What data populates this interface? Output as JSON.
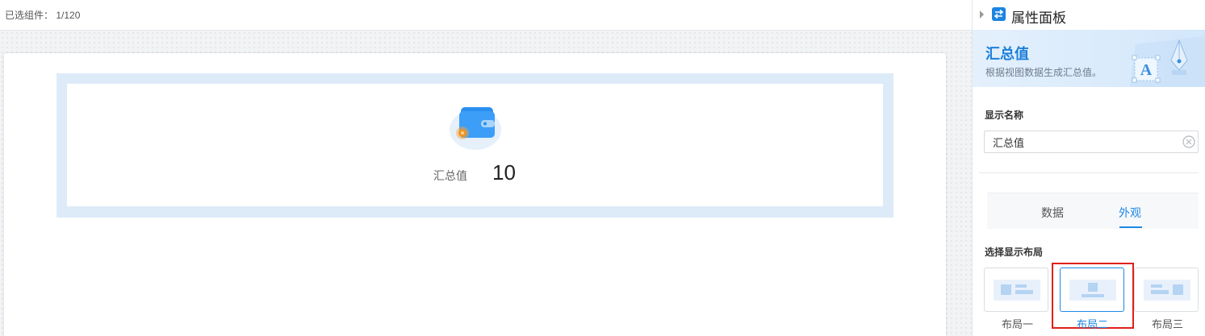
{
  "editor": {
    "selected_components": "已选组件： 1/120",
    "widget": {
      "icon": "wallet-icon",
      "label": "汇总值",
      "value": "10"
    }
  },
  "panel": {
    "title": "属性面板",
    "banner": {
      "title": "汇总值",
      "description": "根据视图数据生成汇总值。"
    },
    "display_name": {
      "label": "显示名称",
      "value": "汇总值"
    },
    "tabs": [
      {
        "label": "数据",
        "active": false
      },
      {
        "label": "外观",
        "active": true
      }
    ],
    "layout": {
      "label": "选择显示布局",
      "options": [
        {
          "label": "布局一",
          "selected": false
        },
        {
          "label": "布局二",
          "selected": true
        },
        {
          "label": "布局三",
          "selected": false
        }
      ]
    }
  },
  "colors": {
    "accent": "#1e88e5",
    "highlight_box": "#e0201b"
  }
}
